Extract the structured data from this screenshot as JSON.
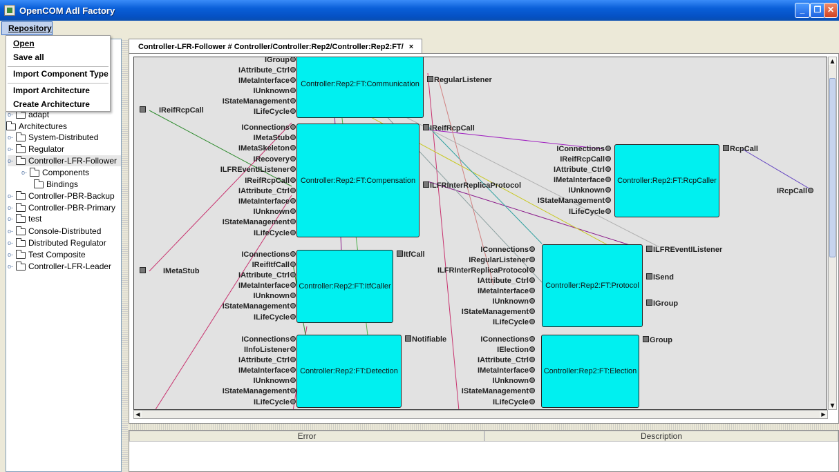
{
  "window": {
    "title": "OpenCOM Adl Factory"
  },
  "menubar": {
    "repository": "Repository"
  },
  "menu": {
    "open": "Open",
    "save_all": "Save all",
    "import_component_type": "Import Component Type",
    "import_architecture": "Import Architecture",
    "create_architecture": "Create Architecture"
  },
  "tree": {
    "adapt": "adapt",
    "architectures": "Architectures",
    "system_distributed": "System-Distributed",
    "regulator": "Regulator",
    "controller_lfr_follower": "Controller-LFR-Follower",
    "components": "Components",
    "bindings": "Bindings",
    "controller_pbr_backup": "Controller-PBR-Backup",
    "controller_pbr_primary": "Controller-PBR-Primary",
    "test": "test",
    "console_distributed": "Console-Distributed",
    "distributed_regulator": "Distributed Regulator",
    "test_composite": "Test Composite",
    "controller_lfr_leader": "Controller-LFR-Leader"
  },
  "tab": {
    "label": "Controller-LFR-Follower # Controller/Controller:Rep2/Controller:Rep2:FT/",
    "close": "×"
  },
  "external": {
    "ireifrcpcall": "IReifRcpCall",
    "imetastub": "IMetaStub",
    "ircpcall": "IRcpCall"
  },
  "components": {
    "communication": {
      "name": "Controller:Rep2:FT:Communication",
      "ports_in": [
        "IGroup",
        "IAttribute_Ctrl",
        "IMetaInterface",
        "IUnknown",
        "IStateManagement",
        "ILifeCycle"
      ],
      "ports_out": [
        "RegularListener"
      ]
    },
    "compensation": {
      "name": "Controller:Rep2:FT:Compensation",
      "ports_in": [
        "IConnections",
        "IMetaStub",
        "IMetaSkeleton",
        "IRecovery",
        "ILFREventIListener",
        "IReifRcpCall",
        "IAttribute_Ctrl",
        "IMetaInterface",
        "IUnknown",
        "IStateManagement",
        "ILifeCycle"
      ],
      "ports_out": [
        "IReifRcpCall",
        "ILFRInterReplicaProtocol"
      ]
    },
    "rcpcaller": {
      "name": "Controller:Rep2:FT:RcpCaller",
      "ports_in": [
        "IConnections",
        "IReifRcpCall",
        "IAttribute_Ctrl",
        "IMetaInterface",
        "IUnknown",
        "IStateManagement",
        "ILifeCycle"
      ],
      "ports_out": [
        "RcpCall"
      ]
    },
    "itfcaller": {
      "name": "Controller:Rep2:FT:ItfCaller",
      "ports_in": [
        "IConnections",
        "IReifItfCall",
        "IAttribute_Ctrl",
        "IMetaInterface",
        "IUnknown",
        "IStateManagement",
        "ILifeCycle"
      ],
      "ports_out": [
        "ItfCall"
      ]
    },
    "protocol": {
      "name": "Controller:Rep2:FT:Protocol",
      "ports_in": [
        "IConnections",
        "IRegularListener",
        "ILFRInterReplicaProtocol",
        "IAttribute_Ctrl",
        "IMetaInterface",
        "IUnknown",
        "IStateManagement",
        "ILifeCycle"
      ],
      "ports_out": [
        "ILFREventIListener",
        "ISend",
        "IGroup"
      ]
    },
    "detection": {
      "name": "Controller:Rep2:FT:Detection",
      "ports_in": [
        "IConnections",
        "IInfoListener",
        "IAttribute_Ctrl",
        "IMetaInterface",
        "IUnknown",
        "IStateManagement",
        "ILifeCycle"
      ],
      "ports_out": [
        "Notifiable"
      ]
    },
    "election": {
      "name": "Controller:Rep2:FT:Election",
      "ports_in": [
        "IConnections",
        "IElection",
        "IAttribute_Ctrl",
        "IMetaInterface",
        "IUnknown",
        "IStateManagement",
        "ILifeCycle"
      ],
      "ports_out": [
        "Group"
      ]
    }
  },
  "errors_table": {
    "col_error": "Error",
    "col_description": "Description"
  },
  "colors": {
    "component_fill": "#00f0f0",
    "title_bar": "#0a5fd8"
  }
}
